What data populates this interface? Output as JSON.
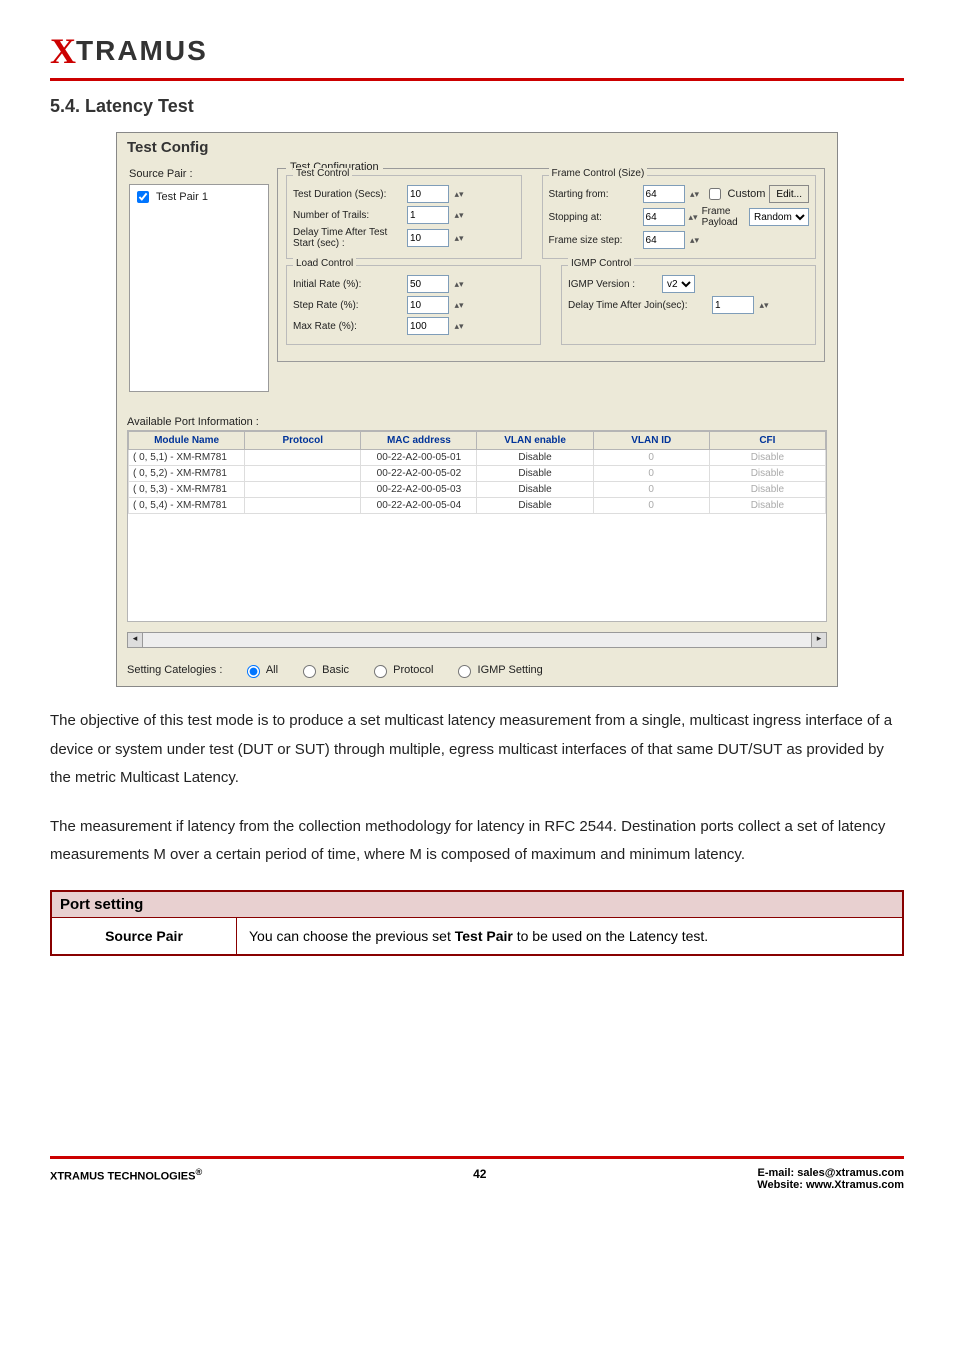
{
  "logo": {
    "x": "X",
    "tramus": "TRAMUS"
  },
  "section": {
    "number_title": "5.4. Latency Test"
  },
  "screenshot": {
    "title": "Test Config",
    "source_pair_label": "Source Pair :",
    "pair_item": "Test Pair 1",
    "test_configuration_label": "Test Configuration",
    "test_control": {
      "legend": "Test Control",
      "duration_label": "Test Duration (Secs):",
      "duration_value": "10",
      "trails_label": "Number of Trails:",
      "trails_value": "1",
      "delay_label": "Delay Time After Test Start (sec)  :",
      "delay_value": "10"
    },
    "frame_control": {
      "legend": "Frame Control (Size)",
      "start_label": "Starting from:",
      "start_value": "64",
      "stop_label": "Stopping at:",
      "stop_value": "64",
      "step_label": "Frame size step:",
      "step_value": "64",
      "custom_label": "Custom",
      "edit_btn": "Edit...",
      "frame_payload_label": "Frame Payload",
      "random_sel": "Random"
    },
    "load_control": {
      "legend": "Load Control",
      "initial_label": "Initial Rate (%):",
      "initial_value": "50",
      "step_label": "Step Rate (%):",
      "step_value": "10",
      "max_label": "Max Rate (%):",
      "max_value": "100"
    },
    "igmp_control": {
      "legend": "IGMP Control",
      "version_label": "IGMP Version :",
      "version_value": "v2",
      "delay_label": "Delay Time After Join(sec):",
      "delay_value": "1"
    },
    "available_label": "Available Port Information :",
    "table": {
      "headers": [
        "Module Name",
        "Protocol",
        "MAC address",
        "VLAN enable",
        "VLAN ID",
        "CFI"
      ],
      "rows": [
        {
          "module": "(  0, 5,1) - XM-RM781",
          "protocol": "",
          "mac": "00-22-A2-00-05-01",
          "vlan_en": "Disable",
          "vlan_id": "0",
          "cfi": "Disable"
        },
        {
          "module": "(  0, 5,2) - XM-RM781",
          "protocol": "",
          "mac": "00-22-A2-00-05-02",
          "vlan_en": "Disable",
          "vlan_id": "0",
          "cfi": "Disable"
        },
        {
          "module": "(  0, 5,3) - XM-RM781",
          "protocol": "",
          "mac": "00-22-A2-00-05-03",
          "vlan_en": "Disable",
          "vlan_id": "0",
          "cfi": "Disable"
        },
        {
          "module": "(  0, 5,4) - XM-RM781",
          "protocol": "",
          "mac": "00-22-A2-00-05-04",
          "vlan_en": "Disable",
          "vlan_id": "0",
          "cfi": "Disable"
        }
      ]
    },
    "settings_row": {
      "label": "Setting Catelogies :",
      "all": "All",
      "basic": "Basic",
      "protocol": "Protocol",
      "igmp": "IGMP Setting"
    }
  },
  "paragraphs": {
    "p1": "The objective of this test mode is to produce a set multicast latency measurement from a single, multicast ingress interface of a device or system under test (DUT or SUT) through multiple, egress multicast interfaces of that same DUT/SUT as provided by the metric Multicast Latency.",
    "p2": "The measurement if latency from the collection methodology for latency in RFC 2544. Destination ports collect a set of latency measurements M over a certain period of time, where M is composed of maximum and minimum latency."
  },
  "port_setting": {
    "header": "Port setting",
    "source_pair_label": "Source Pair",
    "source_pair_desc_pre": "You can choose the previous set ",
    "source_pair_desc_bold": "Test Pair",
    "source_pair_desc_post": " to be used on the Latency test."
  },
  "footer": {
    "left_pre": "XTRAMUS TECHNOLOGIES",
    "reg": "®",
    "page": "42",
    "email_label": "E-mail: ",
    "email": "sales@xtramus.com",
    "web_label": "Website:  ",
    "web": "www.Xtramus.com"
  }
}
